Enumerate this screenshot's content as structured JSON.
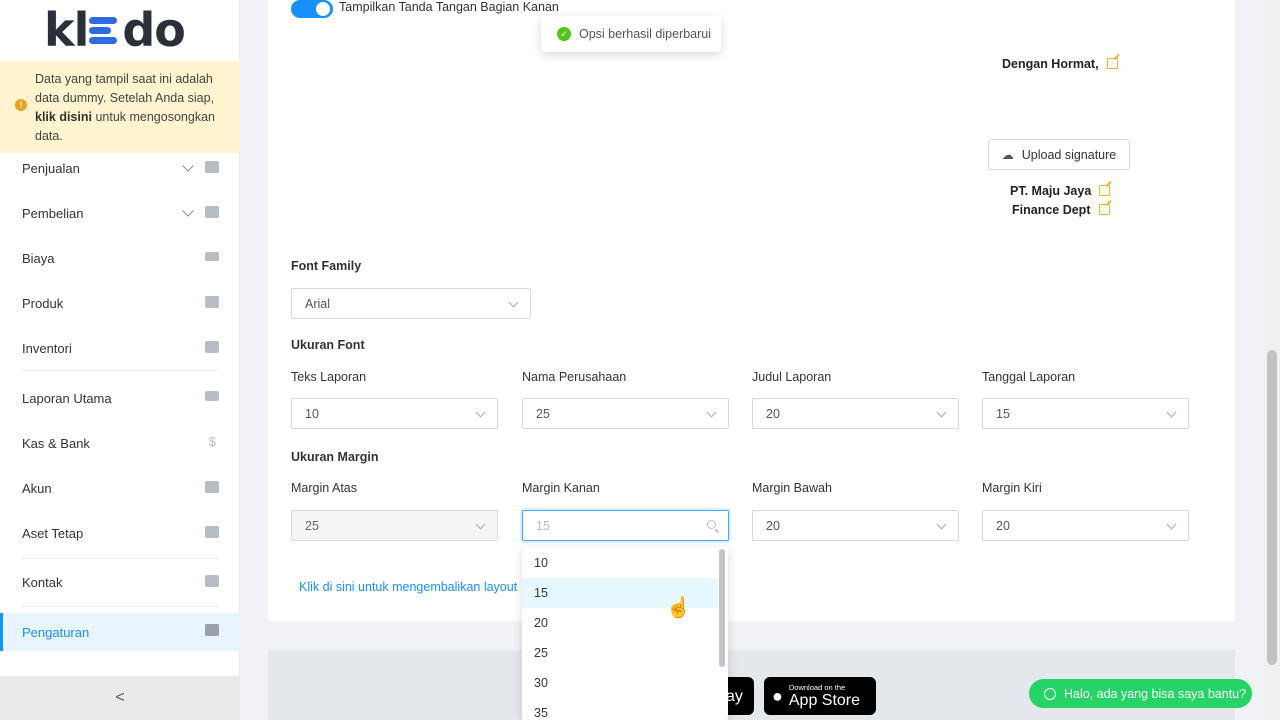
{
  "sidebar": {
    "logo": "kledo",
    "notice": {
      "part1": "Data yang tampil saat ini adalah data dummy. Setelah Anda siap, ",
      "link": "klik disini",
      "part2": " untuk mengosongkan data."
    },
    "items": [
      {
        "label": "Penjualan",
        "icon": "basket-icon",
        "expandable": true
      },
      {
        "label": "Pembelian",
        "icon": "bag-icon",
        "expandable": true
      },
      {
        "label": "Biaya",
        "icon": "credit-card-icon"
      },
      {
        "label": "Produk",
        "icon": "boxes-icon"
      },
      {
        "label": "Inventori",
        "icon": "warehouse-icon"
      },
      {
        "label": "Laporan Utama",
        "icon": "chart-icon"
      },
      {
        "label": "Kas & Bank",
        "icon": "dollar-icon"
      },
      {
        "label": "Akun",
        "icon": "ledger-icon"
      },
      {
        "label": "Aset Tetap",
        "icon": "building-icon"
      },
      {
        "label": "Kontak",
        "icon": "contact-card-icon"
      },
      {
        "label": "Pengaturan",
        "icon": "gears-icon",
        "active": true
      }
    ],
    "collapse_glyph": "<"
  },
  "toggle": {
    "label": "Tampilkan Tanda Tangan Bagian Kanan",
    "on": true
  },
  "toast": {
    "text": "Opsi berhasil diperbarui"
  },
  "signature": {
    "greeting": "Dengan Hormat,",
    "upload_label": "Upload signature",
    "company": "PT. Maju Jaya",
    "dept": "Finance Dept"
  },
  "font_family": {
    "label": "Font Family",
    "value": "Arial"
  },
  "font_size": {
    "section": "Ukuran Font",
    "fields": [
      {
        "label": "Teks Laporan",
        "value": "10"
      },
      {
        "label": "Nama Perusahaan",
        "value": "25"
      },
      {
        "label": "Judul Laporan",
        "value": "20"
      },
      {
        "label": "Tanggal Laporan",
        "value": "15"
      }
    ]
  },
  "margin": {
    "section": "Ukuran Margin",
    "fields": [
      {
        "label": "Margin Atas",
        "value": "25"
      },
      {
        "label": "Margin Kanan",
        "value": "15"
      },
      {
        "label": "Margin Bawah",
        "value": "20"
      },
      {
        "label": "Margin Kiri",
        "value": "20"
      }
    ]
  },
  "reset_link": "Klik di sini untuk mengembalikan layout la",
  "dropdown": {
    "options": [
      "10",
      "15",
      "20",
      "25",
      "30",
      "35"
    ],
    "hovered": "15"
  },
  "store": {
    "play_partial": "ay",
    "appstore_small": "Download on the",
    "appstore_big": "App Store"
  },
  "chat": {
    "label": "Halo, ada yang bisa saya bantu?"
  }
}
